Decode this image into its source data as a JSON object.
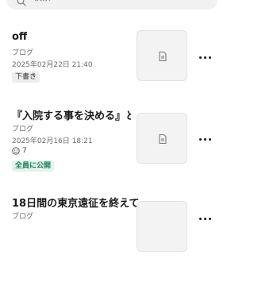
{
  "search": {
    "placeholder": "検索"
  },
  "articles": [
    {
      "title": "off",
      "category": "ブログ",
      "date": "2025年02月22日 21:40",
      "status": "下書き"
    },
    {
      "title": "『入院する事を決める』と…",
      "category": "ブログ",
      "date": "2025年02月16日 18:21",
      "likes": "7",
      "status": "全員に公開"
    },
    {
      "title": "18日間の東京遠征を終えて",
      "category": "ブログ"
    }
  ],
  "icons": {
    "search": "search-icon",
    "thumbnail": "document-icon",
    "more": "more-dots-icon",
    "like": "smile-icon"
  },
  "colors": {
    "public_badge_text": "#15835a",
    "public_badge_bg": "#e3f3ec",
    "draft_badge_bg": "#ededed"
  }
}
